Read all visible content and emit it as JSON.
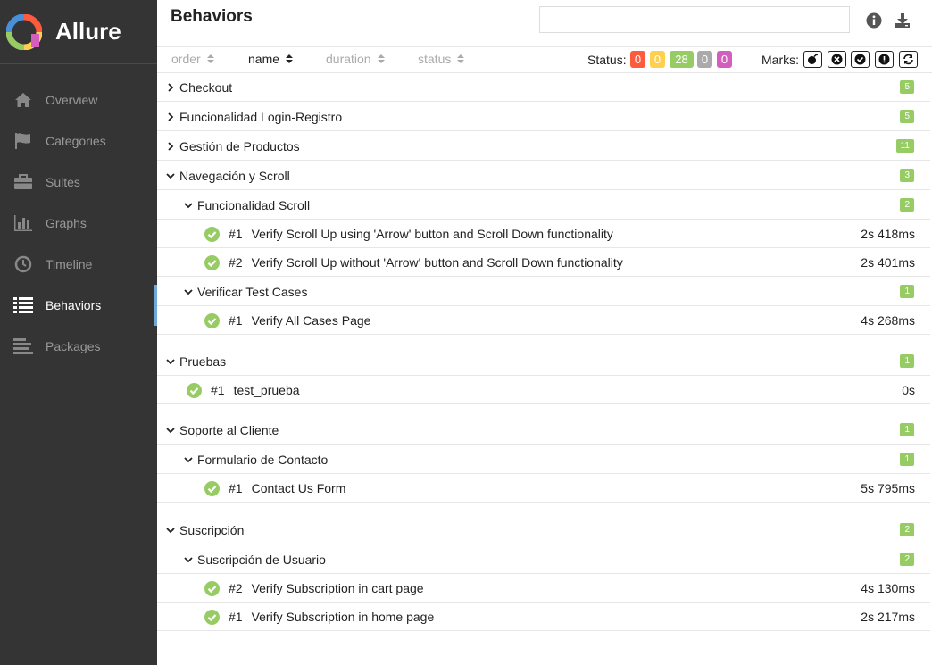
{
  "app": {
    "name": "Allure"
  },
  "sidebar": {
    "items": [
      {
        "label": "Overview",
        "icon": "home-icon"
      },
      {
        "label": "Categories",
        "icon": "flag-icon"
      },
      {
        "label": "Suites",
        "icon": "briefcase-icon"
      },
      {
        "label": "Graphs",
        "icon": "bar-chart-icon"
      },
      {
        "label": "Timeline",
        "icon": "clock-icon"
      },
      {
        "label": "Behaviors",
        "icon": "list-icon",
        "active": true
      },
      {
        "label": "Packages",
        "icon": "align-left-icon"
      }
    ]
  },
  "header": {
    "title": "Behaviors",
    "search_value": ""
  },
  "sort": {
    "columns": [
      "order",
      "name",
      "duration",
      "status"
    ],
    "active": "name"
  },
  "status": {
    "label": "Status:",
    "badges": [
      {
        "value": "0",
        "color": "#fd5a3e"
      },
      {
        "value": "0",
        "color": "#ffd050"
      },
      {
        "value": "28",
        "color": "#97cc64"
      },
      {
        "value": "0",
        "color": "#aaaaaa"
      },
      {
        "value": "0",
        "color": "#d35ebe"
      }
    ]
  },
  "marks": {
    "label": "Marks:"
  },
  "colors": {
    "passed": "#97cc64",
    "sidebar_bg": "#343434",
    "active_accent": "#6ea8dc"
  },
  "tree": [
    {
      "type": "group",
      "level": 0,
      "expanded": false,
      "name": "Checkout",
      "count": "5"
    },
    {
      "type": "group",
      "level": 0,
      "expanded": false,
      "name": "Funcionalidad Login-Registro",
      "count": "5"
    },
    {
      "type": "group",
      "level": 0,
      "expanded": false,
      "name": "Gestión de Productos",
      "count": "11"
    },
    {
      "type": "group",
      "level": 0,
      "expanded": true,
      "name": "Navegación y Scroll",
      "count": "3"
    },
    {
      "type": "group",
      "level": 1,
      "expanded": true,
      "name": "Funcionalidad Scroll",
      "count": "2"
    },
    {
      "type": "test",
      "level": 2,
      "num": "#1",
      "name": "Verify Scroll Up using 'Arrow' button and Scroll Down functionality",
      "duration": "2s 418ms"
    },
    {
      "type": "test",
      "level": 2,
      "num": "#2",
      "name": "Verify Scroll Up without 'Arrow' button and Scroll Down functionality",
      "duration": "2s 401ms"
    },
    {
      "type": "group",
      "level": 1,
      "expanded": true,
      "name": "Verificar Test Cases",
      "count": "1"
    },
    {
      "type": "test",
      "level": 2,
      "num": "#1",
      "name": "Verify All Cases Page",
      "duration": "4s 268ms"
    },
    {
      "type": "group",
      "level": 0,
      "expanded": true,
      "name": "Pruebas",
      "count": "1"
    },
    {
      "type": "test",
      "level": 1,
      "num": "#1",
      "name": "test_prueba",
      "duration": "0s"
    },
    {
      "type": "group",
      "level": 0,
      "expanded": true,
      "name": "Soporte al Cliente",
      "count": "1"
    },
    {
      "type": "group",
      "level": 1,
      "expanded": true,
      "name": "Formulario de Contacto",
      "count": "1"
    },
    {
      "type": "test",
      "level": 2,
      "num": "#1",
      "name": "Contact Us Form",
      "duration": "5s 795ms"
    },
    {
      "type": "group",
      "level": 0,
      "expanded": true,
      "name": "Suscripción",
      "count": "2"
    },
    {
      "type": "group",
      "level": 1,
      "expanded": true,
      "name": "Suscripción de Usuario",
      "count": "2"
    },
    {
      "type": "test",
      "level": 2,
      "num": "#2",
      "name": "Verify Subscription in cart page",
      "duration": "4s 130ms"
    },
    {
      "type": "test",
      "level": 2,
      "num": "#1",
      "name": "Verify Subscription in home page",
      "duration": "2s 217ms"
    }
  ]
}
